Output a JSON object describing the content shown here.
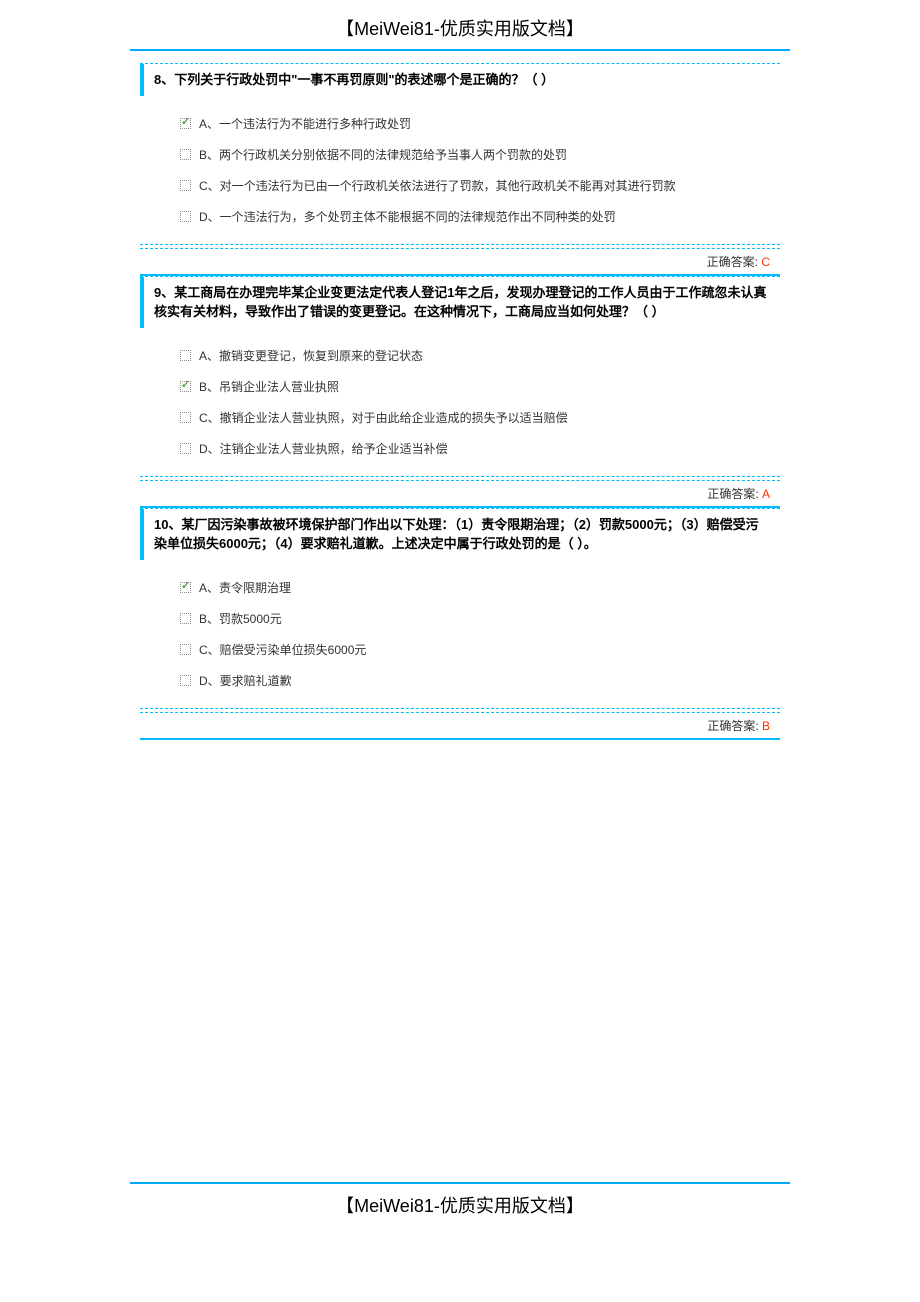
{
  "header": "【MeiWei81-优质实用版文档】",
  "footer": "【MeiWei81-优质实用版文档】",
  "answerLabel": "正确答案: ",
  "questions": [
    {
      "number": "8",
      "text": "8、下列关于行政处罚中\"一事不再罚原则\"的表述哪个是正确的？（ ）",
      "options": [
        {
          "label": "A、一个违法行为不能进行多种行政处罚",
          "checked": true
        },
        {
          "label": "B、两个行政机关分别依据不同的法律规范给予当事人两个罚款的处罚",
          "checked": false
        },
        {
          "label": "C、对一个违法行为已由一个行政机关依法进行了罚款，其他行政机关不能再对其进行罚款",
          "checked": false
        },
        {
          "label": "D、一个违法行为，多个处罚主体不能根据不同的法律规范作出不同种类的处罚",
          "checked": false
        }
      ],
      "answer": "C"
    },
    {
      "number": "9",
      "text": "9、某工商局在办理完毕某企业变更法定代表人登记1年之后，发现办理登记的工作人员由于工作疏忽未认真核实有关材料，导致作出了错误的变更登记。在这种情况下，工商局应当如何处理？（ ）",
      "options": [
        {
          "label": "A、撤销变更登记，恢复到原来的登记状态",
          "checked": false
        },
        {
          "label": "B、吊销企业法人营业执照",
          "checked": true
        },
        {
          "label": "C、撤销企业法人营业执照，对于由此给企业造成的损失予以适当赔偿",
          "checked": false
        },
        {
          "label": "D、注销企业法人营业执照，给予企业适当补偿",
          "checked": false
        }
      ],
      "answer": "A"
    },
    {
      "number": "10",
      "text": "10、某厂因污染事故被环境保护部门作出以下处理：（1）责令限期治理；（2）罚款5000元；（3）赔偿受污染单位损失6000元；（4）要求赔礼道歉。上述决定中属于行政处罚的是（ ）。",
      "options": [
        {
          "label": "A、责令限期治理",
          "checked": true
        },
        {
          "label": "B、罚款5000元",
          "checked": false
        },
        {
          "label": "C、赔偿受污染单位损失6000元",
          "checked": false
        },
        {
          "label": "D、要求赔礼道歉",
          "checked": false
        }
      ],
      "answer": "B"
    }
  ]
}
